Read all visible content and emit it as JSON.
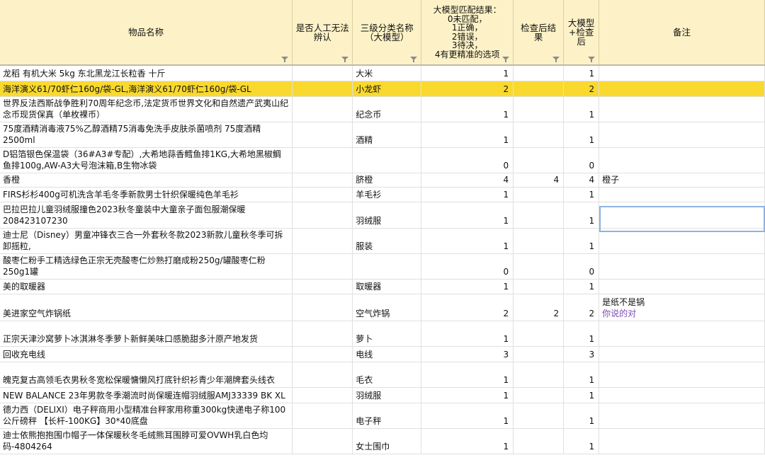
{
  "headers": [
    {
      "label": "物品名称"
    },
    {
      "label": "是否人工无法辨认"
    },
    {
      "label": "三级分类名称（大模型）"
    },
    {
      "label": "大模型匹配结果：\n0未匹配，\n1正确，\n2错误，\n3待决，\n4有更精准的选项"
    },
    {
      "label": "检查后结果"
    },
    {
      "label": "大模型+检查后"
    },
    {
      "label": "备注"
    }
  ],
  "rows": [
    {
      "name": "龙稻 有机大米 5kg 东北黑龙江长粒香 十斤",
      "manual": "",
      "cat": "大米",
      "r1": "1",
      "r2": "",
      "r3": "1",
      "note": ""
    },
    {
      "name": "海洋演义61/70虾仁160g/袋-GL,海洋演义61/70虾仁160g/袋-GL",
      "manual": "",
      "cat": "小龙虾",
      "r1": "2",
      "r2": "",
      "r3": "2",
      "note": ""
    },
    {
      "name": "世界反法西斯战争胜利70周年纪念币,法定货币世界文化和自然遗产武夷山纪念币现货保真（单枚裸币）",
      "manual": "",
      "cat": "纪念币",
      "r1": "1",
      "r2": "",
      "r3": "1",
      "note": ""
    },
    {
      "name": "75度酒精消毒液75%乙醇酒精75消毒免洗手皮肤杀菌喷剂 75度酒精2500ml",
      "manual": "",
      "cat": "酒精",
      "r1": "1",
      "r2": "",
      "r3": "1",
      "note": ""
    },
    {
      "name": "D铝箔银色保温袋（36#A3#专配）,大希地蒜香鳕鱼排1KG,大希地黑椒鲷鱼排100g,AW-A3大号泡沫箱,B生物冰袋",
      "manual": "",
      "cat": "",
      "r1": "0",
      "r2": "",
      "r3": "0",
      "note": ""
    },
    {
      "name": "香橙",
      "manual": "",
      "cat": "脐橙",
      "r1": "4",
      "r2": "4",
      "r3": "4",
      "note": "橙子"
    },
    {
      "name": "FIRS杉杉400g可机洗含羊毛冬季新款男士针织保暖纯色羊毛衫",
      "manual": "",
      "cat": "羊毛衫",
      "r1": "1",
      "r2": "",
      "r3": "1",
      "note": ""
    },
    {
      "name": "巴拉巴拉儿童羽绒服撞色2023秋冬童装中大童亲子面包服潮保暖208423107230",
      "manual": "",
      "cat": "羽绒服",
      "r1": "1",
      "r2": "",
      "r3": "1",
      "note": ""
    },
    {
      "name": "迪士尼（Disney）男童冲锋衣三合一外套秋冬款2023新款儿童秋冬季可拆卸摇粒,",
      "manual": "",
      "cat": "服装",
      "r1": "1",
      "r2": "",
      "r3": "1",
      "note": ""
    },
    {
      "name": "酸枣仁粉手工精选绿色正宗无壳酸枣仁炒熟打磨成粉250g/罐酸枣仁粉250g1罐",
      "manual": "",
      "cat": "",
      "r1": "0",
      "r2": "",
      "r3": "0",
      "note": ""
    },
    {
      "name": "美的取暖器",
      "manual": "",
      "cat": "取暖器",
      "r1": "1",
      "r2": "",
      "r3": "1",
      "note": ""
    },
    {
      "name": "美进家空气炸锅纸",
      "manual": "",
      "cat": "空气炸锅",
      "r1": "2",
      "r2": "2",
      "r3": "2",
      "note": "是纸不是锅",
      "note2": "你说的对"
    },
    {
      "name": "正宗天津沙窝萝卜冰淇淋冬季萝卜新鲜美味口感脆甜多汁原产地发货",
      "manual": "",
      "cat": "萝卜",
      "r1": "1",
      "r2": "",
      "r3": "1",
      "note": ""
    },
    {
      "name": "回收充电线",
      "manual": "",
      "cat": "电线",
      "r1": "3",
      "r2": "",
      "r3": "3",
      "note": ""
    },
    {
      "name": "魄克复古高领毛衣男秋冬宽松保暖慵懒风打底针织衫青少年潮牌套头线衣",
      "manual": "",
      "cat": "毛衣",
      "r1": "1",
      "r2": "",
      "r3": "1",
      "note": ""
    },
    {
      "name": "NEW BALANCE 23年男款冬季潮流时尚保暖连帽羽绒服AMJ33339 BK XL",
      "manual": "",
      "cat": "羽绒服",
      "r1": "1",
      "r2": "",
      "r3": "1",
      "note": ""
    },
    {
      "name": "德力西（DELIXI）电子秤商用小型精准台秤家用称重300kg快递电子称100公斤磅秤 【长杆-100KG】30*40底盘",
      "manual": "",
      "cat": "电子秤",
      "r1": "1",
      "r2": "",
      "r3": "1",
      "note": ""
    },
    {
      "name": "迪士依熊抱抱围巾帽子一体保暖秋冬毛绒熊耳围脖可爱OVWH乳白色均码-4804264",
      "manual": "",
      "cat": "女士围巾",
      "r1": "1",
      "r2": "",
      "r3": "1",
      "note": ""
    }
  ]
}
